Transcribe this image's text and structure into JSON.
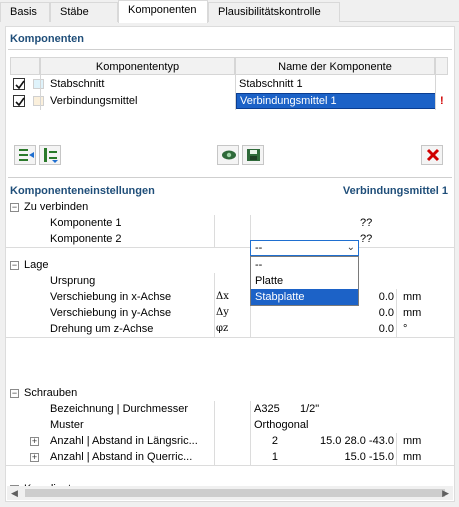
{
  "tabs": [
    "Basis",
    "Stäbe",
    "Komponenten",
    "Plausibilitätskontrolle"
  ],
  "components": {
    "title": "Komponenten",
    "col_type": "Komponententyp",
    "col_name": "Name der Komponente",
    "rows": [
      {
        "checked": true,
        "swatch": "#dff3fb",
        "type": "Stabschnitt",
        "name": "Stabschnitt 1",
        "selected": false,
        "warning": ""
      },
      {
        "checked": true,
        "swatch": "#fbf0dc",
        "type": "Verbindungsmittel",
        "name": "Verbindungsmittel 1",
        "selected": true,
        "warning": "!"
      }
    ]
  },
  "settings": {
    "title": "Komponenteneinstellungen",
    "current": "Verbindungsmittel 1",
    "groups": {
      "zu_verbinden": {
        "label": "Zu verbinden",
        "k1_label": "Komponente 1",
        "k1_value": "--",
        "k1_extra": "??",
        "k2_label": "Komponente 2",
        "k2_extra": "??",
        "dropdown_options": [
          "--",
          "Platte",
          "Stabplatte"
        ],
        "dropdown_highlight": "Stabplatte"
      },
      "lage": {
        "label": "Lage",
        "ursprung_label": "Ursprung",
        "ursprung_value": "??",
        "vx_label": "Verschiebung in x-Achse",
        "vx_sym": "Δx",
        "vx_value": "0.0",
        "vx_unit": "mm",
        "vy_label": "Verschiebung in y-Achse",
        "vy_sym": "Δy",
        "vy_value": "0.0",
        "vy_unit": "mm",
        "rz_label": "Drehung um z-Achse",
        "rz_sym": "φz",
        "rz_value": "0.0",
        "rz_unit": "°"
      },
      "schrauben": {
        "label": "Schrauben",
        "bez_label": "Bezeichnung | Durchmesser",
        "bez_v1": "A325",
        "bez_v2": "1/2\"",
        "muster_label": "Muster",
        "muster_value": "Orthogonal",
        "laengs_label": "Anzahl | Abstand in Längsric...",
        "laengs_n": "2",
        "laengs_v": "15.0 28.0 -43.0",
        "laengs_unit": "mm",
        "quer_label": "Anzahl | Abstand in Querric...",
        "quer_n": "1",
        "quer_v": "15.0 -15.0",
        "quer_unit": "mm"
      },
      "koordinaten": {
        "label": "Koordinaten"
      }
    }
  },
  "icons": [
    "insert-rows-icon",
    "insert-rows-alt-icon",
    "view-icon",
    "save-icon",
    "delete-icon"
  ],
  "colors": {
    "accent": "#1f4e79",
    "selection": "#1c62c7",
    "delete": "#d00000"
  }
}
